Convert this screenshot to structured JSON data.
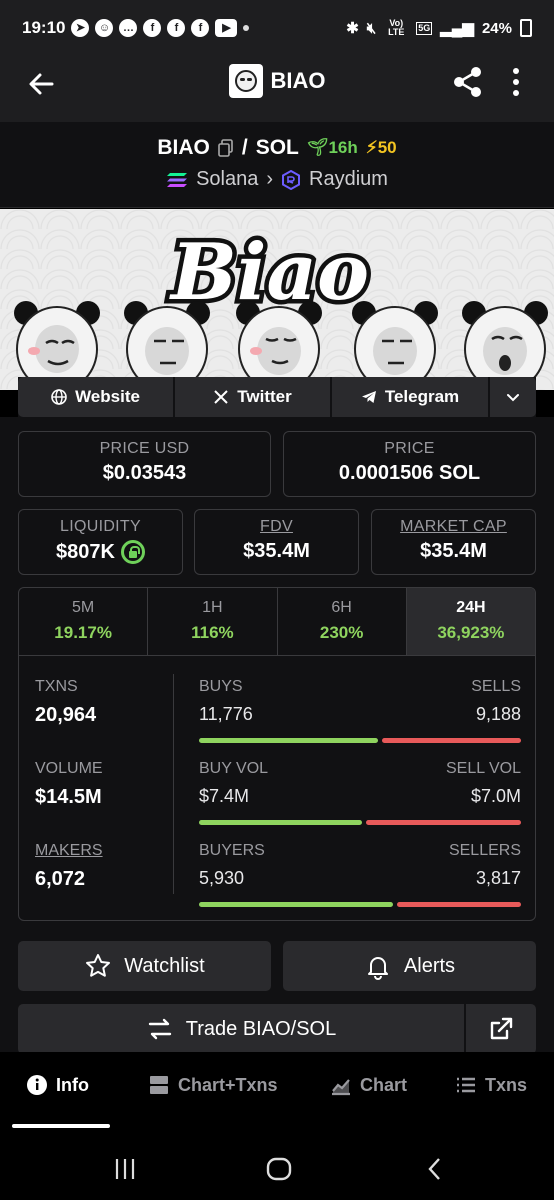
{
  "status_bar": {
    "time": "19:10",
    "network": "Vo) LTE",
    "gen": "5G",
    "battery": "24%"
  },
  "app_bar": {
    "title": "BIAO"
  },
  "pair": {
    "base": "BIAO",
    "sep": "/",
    "quote": "SOL",
    "age": "16h",
    "boost": "50",
    "chain": "Solana",
    "dex": "Raydium"
  },
  "links": {
    "website": "Website",
    "twitter": "Twitter",
    "telegram": "Telegram"
  },
  "prices": {
    "usd_label": "PRICE USD",
    "usd_value": "$0.03543",
    "native_label": "PRICE",
    "native_value": "0.0001506 SOL"
  },
  "metrics": {
    "liquidity_label": "LIQUIDITY",
    "liquidity_value": "$807K",
    "fdv_label": "FDV",
    "fdv_value": "$35.4M",
    "mcap_label": "MARKET CAP",
    "mcap_value": "$35.4M"
  },
  "timeframes": [
    {
      "name": "5M",
      "pct": "19.17%"
    },
    {
      "name": "1H",
      "pct": "116%"
    },
    {
      "name": "6H",
      "pct": "230%"
    },
    {
      "name": "24H",
      "pct": "36,923%"
    }
  ],
  "stats": {
    "txns_label": "TXNS",
    "txns_value": "20,964",
    "buys_label": "BUYS",
    "buys_value": "11,776",
    "sells_label": "SELLS",
    "sells_value": "9,188",
    "volume_label": "VOLUME",
    "volume_value": "$14.5M",
    "buyvol_label": "BUY VOL",
    "buyvol_value": "$7.4M",
    "sellvol_label": "SELL VOL",
    "sellvol_value": "$7.0M",
    "makers_label": "MAKERS",
    "makers_value": "6,072",
    "buyers_label": "BUYERS",
    "buyers_value": "5,930",
    "sellers_label": "SELLERS",
    "sellers_value": "3,817",
    "buy_fraction_txns": 0.562,
    "buy_fraction_vol": 0.514,
    "buy_fraction_makers": 0.609
  },
  "actions": {
    "watchlist": "Watchlist",
    "alerts": "Alerts",
    "trade": "Trade BIAO/SOL"
  },
  "bottom_nav": [
    {
      "label": "Info",
      "icon": "info-icon"
    },
    {
      "label": "Chart+Txns",
      "icon": "chart-txns-icon"
    },
    {
      "label": "Chart",
      "icon": "chart-icon"
    },
    {
      "label": "Txns",
      "icon": "list-icon"
    }
  ],
  "colors": {
    "green": "#8fd45f",
    "red": "#e85a5a",
    "panel": "#111113",
    "button": "#2a2a2d"
  }
}
